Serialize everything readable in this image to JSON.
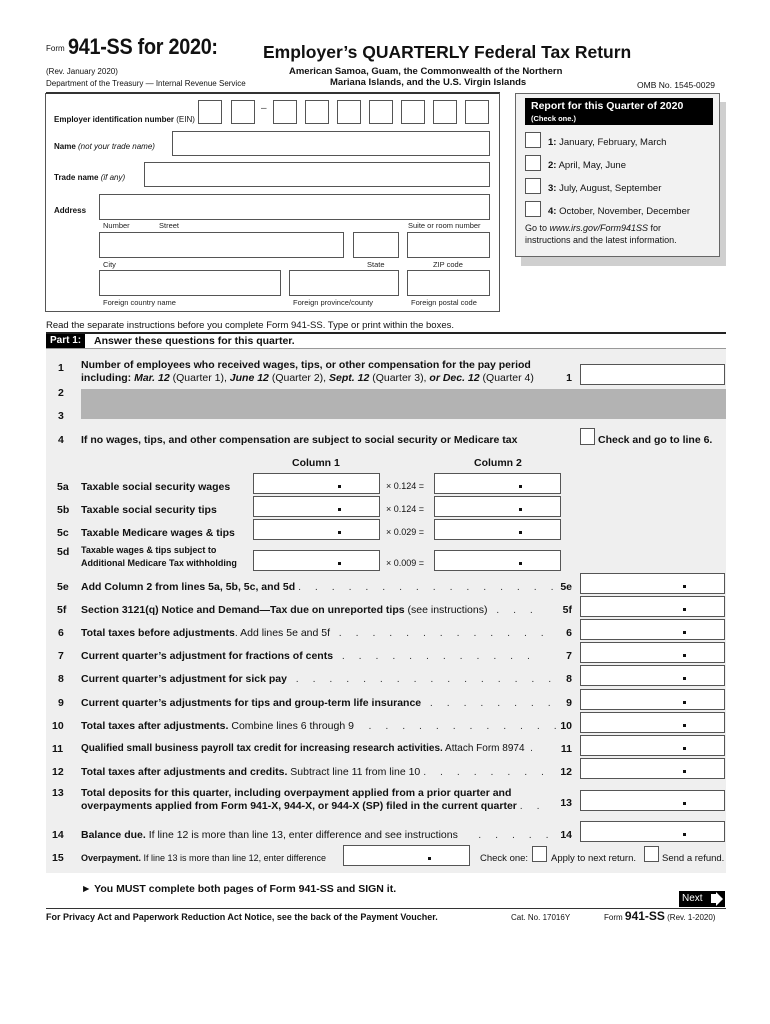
{
  "header": {
    "form_prefix": "Form",
    "form_title": "941-SS for 2020:",
    "rev": "(Rev. January 2020)",
    "dept": "Department of the Treasury — Internal Revenue Service",
    "main_title": "Employer’s QUARTERLY Federal Tax Return",
    "subtitle_line1": "American Samoa, Guam, the Commonwealth of the Northern",
    "subtitle_line2": "Mariana Islands, and the U.S. Virgin Islands",
    "omb": "OMB No. 1545-0029"
  },
  "employer": {
    "ein_label_bold": "Employer identification number",
    "ein_label_rest": " (EIN)",
    "ein_dash": "–",
    "ein_digits": [
      "",
      "",
      "",
      "",
      "",
      "",
      "",
      "",
      ""
    ],
    "name_label_bold": "Name",
    "name_label_ital": " (not your trade name)",
    "name_value": "",
    "trade_label_bold": "Trade name",
    "trade_label_ital": " (if any)",
    "trade_value": "",
    "address_label": "Address",
    "street_value": "",
    "number_label": "Number",
    "street_label": "Street",
    "suite_label": "Suite or room number",
    "city_label": "City",
    "state_label": "State",
    "zip_label": "ZIP code",
    "foreign_country_label": "Foreign country name",
    "foreign_province_label": "Foreign province/county",
    "foreign_postal_label": "Foreign postal code"
  },
  "quarter_box": {
    "title": "Report for this Quarter of 2020",
    "subtitle": "(Check one.)",
    "options": [
      {
        "num": "1:",
        "label": " January, February, March",
        "checked": false
      },
      {
        "num": "2:",
        "label": " April, May, June",
        "checked": false
      },
      {
        "num": "3:",
        "label": " July, August, September",
        "checked": false
      },
      {
        "num": "4:",
        "label": " October, November, December",
        "checked": false
      }
    ],
    "note_prefix": "Go to ",
    "note_link": "www.irs.gov/Form941SS",
    "note_suffix": " for",
    "note_line2": "instructions and the latest information."
  },
  "instructions": "Read the separate instructions before you complete Form 941-SS. Type or print within the boxes.",
  "part1": {
    "tag": "Part 1:",
    "title": "Answer these questions for this quarter.",
    "line1": {
      "num": "1",
      "text_line1": "Number of employees who received wages, tips, or other compensation for the pay period",
      "text_line2_parts": [
        "including: ",
        "Mar. 12",
        " (Quarter 1), ",
        "June 12",
        " (Quarter 2), ",
        "Sept. 12",
        " (Quarter 3), ",
        "or Dec. 12",
        " (Quarter 4)"
      ],
      "ref": "1",
      "value": ""
    },
    "line2_num": "2",
    "line3_num": "3",
    "line4": {
      "num": "4",
      "text": "If no wages, tips, and other compensation are subject to social security or Medicare tax",
      "check_label": "Check and go to line 6."
    },
    "col1_header": "Column 1",
    "col2_header": "Column 2",
    "line5_rows": [
      {
        "num": "5a",
        "label": "Taxable social security wages",
        "rate": "× 0.124 =",
        "col1": "",
        "col2": ""
      },
      {
        "num": "5b",
        "label": "Taxable social security tips",
        "rate": "× 0.124 =",
        "col1": "",
        "col2": ""
      },
      {
        "num": "5c",
        "label": "Taxable Medicare wages & tips",
        "rate": "× 0.029 =",
        "col1": "",
        "col2": ""
      },
      {
        "num": "5d",
        "label_line1": "Taxable wages & tips subject to",
        "label_line2": "Additional Medicare Tax withholding",
        "rate": "× 0.009 =",
        "col1": "",
        "col2": ""
      }
    ],
    "lines": [
      {
        "num": "5e",
        "bold": "Add Column 2 from lines 5a, 5b, 5c, and 5d",
        "rest": "",
        "leader": ". . . . . . . . . . . . . . . .",
        "ref": "5e",
        "value": ""
      },
      {
        "num": "5f",
        "bold": "Section 3121(q) Notice and Demand—Tax due on unreported tips",
        "rest": " (see instructions)",
        "leader": ". . .",
        "ref": "5f",
        "value": ""
      },
      {
        "num": "6",
        "bold": "Total taxes before adjustments",
        "rest": ". Add lines 5e and 5f",
        "leader": ". . . . . . . . . . . . .",
        "ref": "6",
        "value": ""
      },
      {
        "num": "7",
        "bold": "Current quarter’s adjustment for fractions of cents",
        "rest": "",
        "leader": ". . . . . . . . . . . .",
        "ref": "7",
        "value": ""
      },
      {
        "num": "8",
        "bold": "Current quarter’s adjustment for sick pay",
        "rest": "",
        "leader": ". . . . . . . . . . . . . . . .",
        "ref": "8",
        "value": ""
      },
      {
        "num": "9",
        "bold": "Current quarter’s adjustments for tips and group-term life insurance",
        "rest": "",
        "leader": ". . . . . . . .",
        "ref": "9",
        "value": ""
      },
      {
        "num": "10",
        "bold": "Total taxes after adjustments.",
        "rest": " Combine lines 6 through 9",
        "leader": ". . . . . . . . . . . .",
        "ref": "10",
        "value": ""
      },
      {
        "num": "11",
        "bold": "Qualified small business payroll tax credit for increasing research activities.",
        "rest": " Attach Form 8974",
        "leader": ".",
        "ref": "11",
        "value": ""
      },
      {
        "num": "12",
        "bold": "Total taxes after adjustments and credits.",
        "rest": " Subtract line 11 from line 10",
        "leader": ". . . . . . . .",
        "ref": "12",
        "value": ""
      }
    ],
    "line13": {
      "num": "13",
      "text_line1": "Total deposits for this quarter, including overpayment applied from a prior quarter and",
      "text_line2": "overpayments applied from Form 941-X, 944-X, or 944-X (SP) filed in the current quarter",
      "leader": ". .",
      "ref": "13",
      "value": ""
    },
    "line14": {
      "num": "14",
      "bold": "Balance due.",
      "rest": " If line 12 is more than line 13, enter difference and see instructions",
      "leader": ". . . . . .",
      "ref": "14",
      "value": ""
    },
    "line15": {
      "num": "15",
      "bold": "Overpayment.",
      "rest": " If line 13 is more than line 12, enter difference",
      "value": "",
      "check_one": "Check one:",
      "apply_label": "Apply to next return.",
      "refund_label": "Send a refund."
    }
  },
  "must_complete": "► You MUST complete both pages of Form 941-SS and SIGN it.",
  "next_button": "Next",
  "footer": {
    "privacy": "For Privacy Act and Paperwork Reduction Act Notice, see the back of the Payment Voucher.",
    "cat_no": "Cat. No. 17016Y",
    "form_prefix": "Form ",
    "form_name": "941-SS",
    "form_rev": " (Rev. 1-2020)"
  }
}
